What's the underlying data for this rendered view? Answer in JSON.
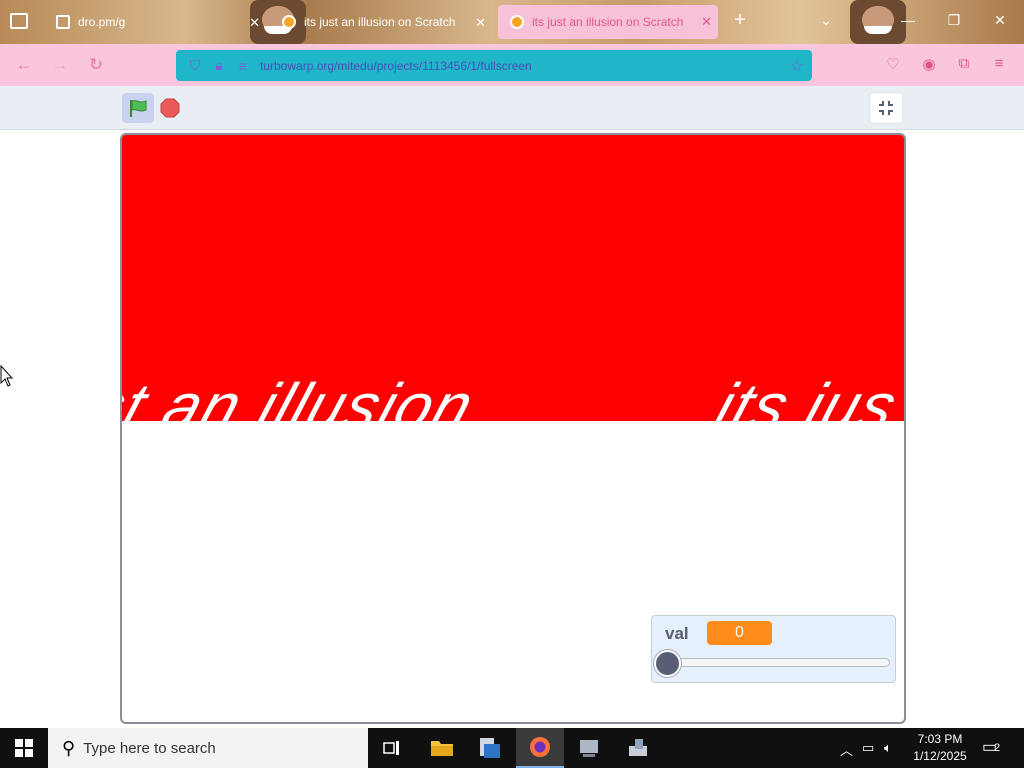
{
  "browser": {
    "tabs": [
      {
        "title": "dro.pm/g",
        "icon": "folder-icon"
      },
      {
        "title": "its just an illusion on Scratch",
        "icon": "scratch-icon"
      },
      {
        "title": "its just an illusion on Scratch",
        "icon": "scratch-icon",
        "active": true
      }
    ],
    "new_tab_label": "+",
    "url": "turbowarp.org/mitedu/projects/1113456/1/fullscreen"
  },
  "player": {
    "stage_text": "its just an illusion",
    "stage_text_left_fragment": "st an illusion",
    "stage_text_right_fragment": "its jus",
    "variable_monitor": {
      "label": "val",
      "value": "0",
      "slider_fraction": 0
    }
  },
  "taskbar": {
    "search_placeholder": "Type here to search",
    "time": "7:03 PM",
    "date": "1/12/2025",
    "notification_count": "2"
  },
  "colors": {
    "stage_red": "#ff0000",
    "monitor_value": "#ff8c1a",
    "tab_active": "#f7c1d8",
    "url_bar": "#1fb6c9"
  }
}
